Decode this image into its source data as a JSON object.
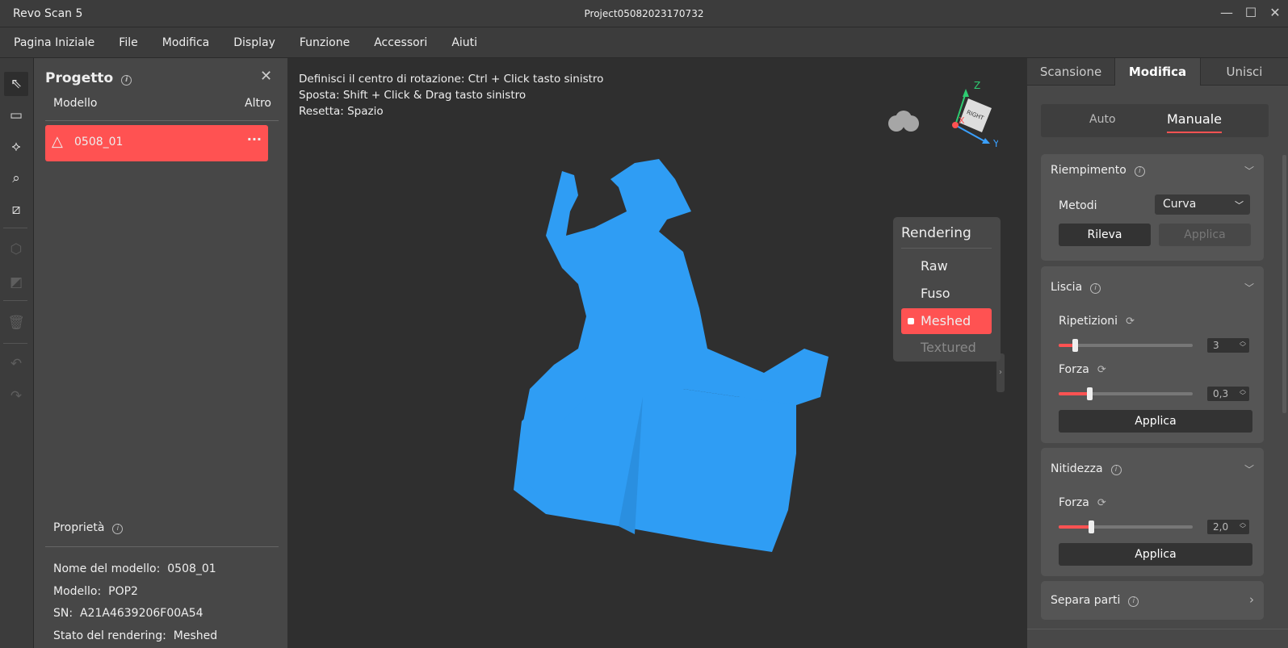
{
  "window": {
    "app_title": "Revo Scan 5",
    "project_title": "Project05082023170732"
  },
  "menu": [
    "Pagina Iniziale",
    "File",
    "Modifica",
    "Display",
    "Funzione",
    "Accessori",
    "Aiuti"
  ],
  "project": {
    "title": "Progetto",
    "col_model": "Modello",
    "col_other": "Altro",
    "model_item": "0508_01"
  },
  "properties": {
    "title": "Proprietà",
    "rows": [
      {
        "label": "Nome del modello:",
        "value": "0508_01"
      },
      {
        "label": "Modello:",
        "value": "POP2"
      },
      {
        "label": "SN:",
        "value": "A21A4639206F00A54"
      },
      {
        "label": "Stato del rendering:",
        "value": "Meshed"
      }
    ]
  },
  "viewport": {
    "hints": [
      "Definisci il centro di rotazione: Ctrl + Click tasto sinistro",
      "Sposta: Shift + Click & Drag tasto sinistro",
      "Resetta: Spazio"
    ],
    "gizmo": {
      "face": "RIGHT",
      "x": "X",
      "y": "Y",
      "z": "Z"
    },
    "model_color": "#2f9df4"
  },
  "rendering": {
    "title": "Rendering",
    "options": [
      "Raw",
      "Fuso",
      "Meshed",
      "Textured"
    ],
    "selected": "Meshed",
    "accent": "#ff5252"
  },
  "right": {
    "tabs": [
      "Scansione",
      "Modifica",
      "Unisci"
    ],
    "active_tab": "Modifica",
    "subtabs": [
      "Auto",
      "Manuale"
    ],
    "active_subtab": "Manuale",
    "riempimento": {
      "title": "Riempimento",
      "method_label": "Metodi",
      "method_value": "Curva",
      "detect": "Rileva",
      "apply": "Applica"
    },
    "liscia": {
      "title": "Liscia",
      "rep_label": "Ripetizioni",
      "rep_value": "3",
      "rep_fraction": 0.12,
      "force_label": "Forza",
      "force_value": "0,3",
      "force_fraction": 0.23,
      "apply": "Applica"
    },
    "nitidezza": {
      "title": "Nitidezza",
      "force_label": "Forza",
      "force_value": "2,0",
      "force_fraction": 0.24,
      "apply": "Applica"
    },
    "separa": {
      "title": "Separa parti"
    }
  }
}
